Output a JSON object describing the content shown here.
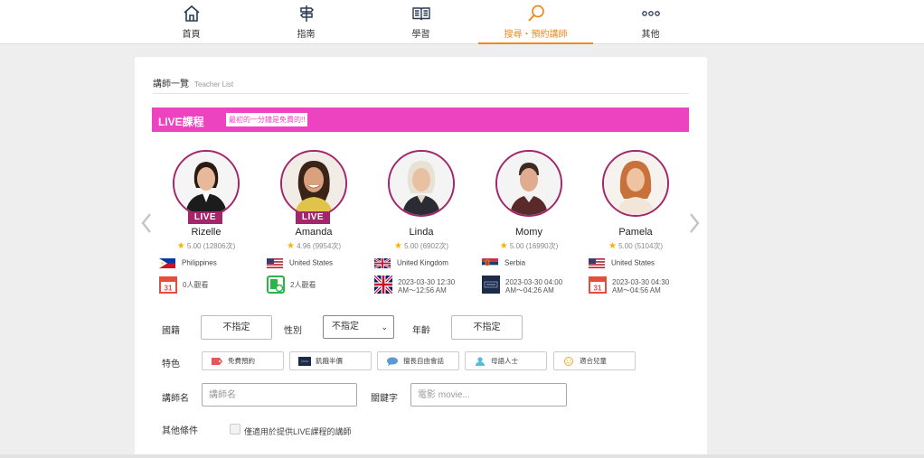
{
  "nav": {
    "items": [
      {
        "label": "首頁",
        "icon": "home-icon",
        "active": false
      },
      {
        "label": "指南",
        "icon": "signpost-icon",
        "active": false
      },
      {
        "label": "學習",
        "icon": "book-icon",
        "active": false
      },
      {
        "label": "搜尋・預約講師",
        "icon": "search-icon",
        "active": true
      },
      {
        "label": "其他",
        "icon": "more-icon",
        "active": false
      }
    ]
  },
  "page": {
    "title_zh": "講師一覽",
    "title_en": "Teacher List"
  },
  "live_banner": {
    "title": "LIVE課程",
    "tag": "最初的一分鐘是免費的!!"
  },
  "colors": {
    "accent": "#f08a1c",
    "live_pink": "#ee43c0",
    "ring": "#a3256b",
    "star": "#f6b400"
  },
  "teachers": [
    {
      "name": "Rizelle",
      "live": "LIVE",
      "rating": "5.00 (12806次)",
      "country": "Philippines",
      "flag": "ph",
      "info_icon": "calendar-icon",
      "info": "0人觀看",
      "info2": ""
    },
    {
      "name": "Amanda",
      "live": "LIVE",
      "rating": "4.96 (9954次)",
      "country": "United States",
      "flag": "us",
      "info_icon": "viewers-icon",
      "info": "2人觀看",
      "info2": ""
    },
    {
      "name": "Linda",
      "live": "",
      "rating": "5.00 (6902次)",
      "country": "United Kingdom",
      "flag": "uk",
      "info_icon": "uk-flag-icon",
      "info": "2023-03-30 12:30",
      "info2": "AM～12:56 AM"
    },
    {
      "name": "Momy",
      "live": "",
      "rating": "5.00 (16990次)",
      "country": "Serbia",
      "flag": "rs",
      "info_icon": "lesson-thumbnail-icon",
      "info": "2023-03-30 04:00",
      "info2": "AM～04:26 AM"
    },
    {
      "name": "Pamela",
      "live": "",
      "rating": "5.00 (5104次)",
      "country": "United States",
      "flag": "us",
      "info_icon": "calendar-icon",
      "info": "2023-03-30 04:30",
      "info2": "AM～04:56 AM"
    }
  ],
  "filters": {
    "nationality_label": "國籍",
    "nationality_value": "不指定",
    "gender_label": "性別",
    "gender_value": "不指定",
    "age_label": "年齡",
    "age_value": "不指定",
    "features_label": "特色",
    "features": [
      {
        "label": "免費預約",
        "icon": "tag-icon"
      },
      {
        "label": "飢餓半價",
        "icon": "thumbnail-icon"
      },
      {
        "label": "擅長自由會話",
        "icon": "chat-bubble-icon"
      },
      {
        "label": "母語人士",
        "icon": "person-icon"
      },
      {
        "label": "適合兒童",
        "icon": "smiley-icon"
      }
    ],
    "teacher_name_label": "講師名",
    "teacher_name_placeholder": "講師名",
    "keyword_label": "關鍵字",
    "keyword_placeholder": "電影 movie...",
    "other_label": "其他條件",
    "live_only_label": "僅適用於提供LIVE課程的講師"
  }
}
